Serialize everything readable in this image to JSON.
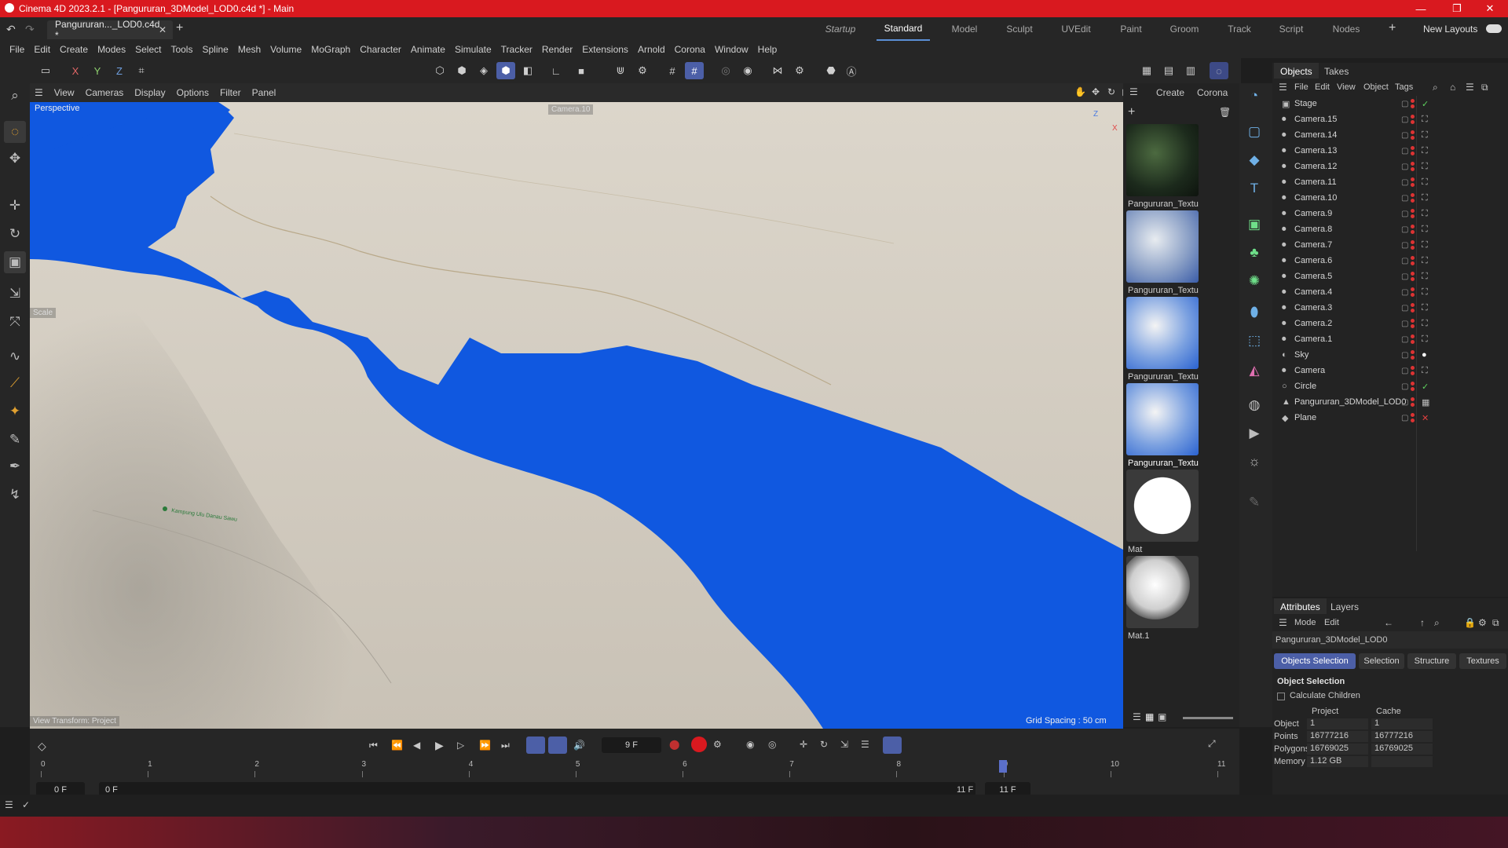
{
  "window": {
    "title": "Cinema 4D 2023.2.1 - [Pangururan_3DModel_LOD0.c4d *] - Main"
  },
  "tabs": {
    "document": "Pangururan..._LOD0.c4d *",
    "layouts": [
      "Startup",
      "Standard",
      "Model",
      "Sculpt",
      "UVEdit",
      "Paint",
      "Groom",
      "Track",
      "Script",
      "Nodes"
    ],
    "active_layout": "Standard",
    "new_layouts": "New Layouts"
  },
  "menu": [
    "File",
    "Edit",
    "Create",
    "Modes",
    "Select",
    "Tools",
    "Spline",
    "Mesh",
    "Volume",
    "MoGraph",
    "Character",
    "Animate",
    "Simulate",
    "Tracker",
    "Render",
    "Extensions",
    "Arnold",
    "Corona",
    "Window",
    "Help"
  ],
  "axis_buttons": [
    "X",
    "Y",
    "Z"
  ],
  "viewport": {
    "menu": [
      "View",
      "Cameras",
      "Display",
      "Options",
      "Filter",
      "Panel"
    ],
    "mode": "Perspective",
    "camera": "Camera.10",
    "tool": "Scale",
    "transform": "View Transform: Project",
    "grid": "Grid Spacing : 50 cm",
    "map_label": "Kampung Ulu Danau Sawu"
  },
  "materials": {
    "menu": [
      "Create",
      "Corona"
    ],
    "items": [
      {
        "name": "Pangururan_Textu"
      },
      {
        "name": "Pangururan_Textu"
      },
      {
        "name": "Pangururan_Textu"
      },
      {
        "name": "Pangururan_Textu"
      },
      {
        "name": "Mat"
      },
      {
        "name": "Mat.1"
      }
    ]
  },
  "objects_panel": {
    "tabs": [
      "Objects",
      "Takes"
    ],
    "menu": [
      "File",
      "Edit",
      "View",
      "Object",
      "Tags"
    ],
    "items": [
      {
        "name": "Stage",
        "icon": "stage-icon"
      },
      {
        "name": "Camera.15",
        "icon": "camera-icon"
      },
      {
        "name": "Camera.14",
        "icon": "camera-icon"
      },
      {
        "name": "Camera.13",
        "icon": "camera-icon"
      },
      {
        "name": "Camera.12",
        "icon": "camera-icon"
      },
      {
        "name": "Camera.11",
        "icon": "camera-icon"
      },
      {
        "name": "Camera.10",
        "icon": "camera-icon"
      },
      {
        "name": "Camera.9",
        "icon": "camera-icon"
      },
      {
        "name": "Camera.8",
        "icon": "camera-icon"
      },
      {
        "name": "Camera.7",
        "icon": "camera-icon"
      },
      {
        "name": "Camera.6",
        "icon": "camera-icon"
      },
      {
        "name": "Camera.5",
        "icon": "camera-icon"
      },
      {
        "name": "Camera.4",
        "icon": "camera-icon"
      },
      {
        "name": "Camera.3",
        "icon": "camera-icon"
      },
      {
        "name": "Camera.2",
        "icon": "camera-icon"
      },
      {
        "name": "Camera.1",
        "icon": "camera-icon"
      },
      {
        "name": "Sky",
        "icon": "sky-icon"
      },
      {
        "name": "Camera",
        "icon": "camera-icon"
      },
      {
        "name": "Circle",
        "icon": "circle-icon"
      },
      {
        "name": "Pangururan_3DModel_LOD0",
        "icon": "polygon-object-icon"
      },
      {
        "name": "Plane",
        "icon": "plane-icon"
      }
    ]
  },
  "attributes": {
    "tabs": [
      "Attributes",
      "Layers"
    ],
    "menu": [
      "Mode",
      "Edit"
    ],
    "object_name": "Pangururan_3DModel_LOD0",
    "subtabs": [
      "Objects Selection",
      "Selection",
      "Structure",
      "Textures"
    ],
    "section": "Object Selection",
    "checkbox": "Calculate Children",
    "headers": [
      "Project",
      "Cache"
    ],
    "rows": [
      {
        "label": "Object",
        "project": "1",
        "cache": "1"
      },
      {
        "label": "Points",
        "project": "16777216",
        "cache": "16777216"
      },
      {
        "label": "Polygons",
        "project": "16769025",
        "cache": "16769025"
      },
      {
        "label": "Memory",
        "project": "1.12 GB",
        "cache": ""
      }
    ]
  },
  "timeline": {
    "current_frame": "9 F",
    "ruler": [
      "0",
      "1",
      "2",
      "3",
      "4",
      "5",
      "6",
      "7",
      "8",
      "9",
      "10",
      "11"
    ],
    "playhead_frame": 9,
    "total_frames": 11,
    "start_a": "0 F",
    "start_b": "0 F",
    "end_a": "11 F",
    "end_b": "11 F"
  },
  "colors": {
    "accent": "#4c5fa7",
    "water": "#1058e0",
    "titlebar": "#d9191f"
  }
}
